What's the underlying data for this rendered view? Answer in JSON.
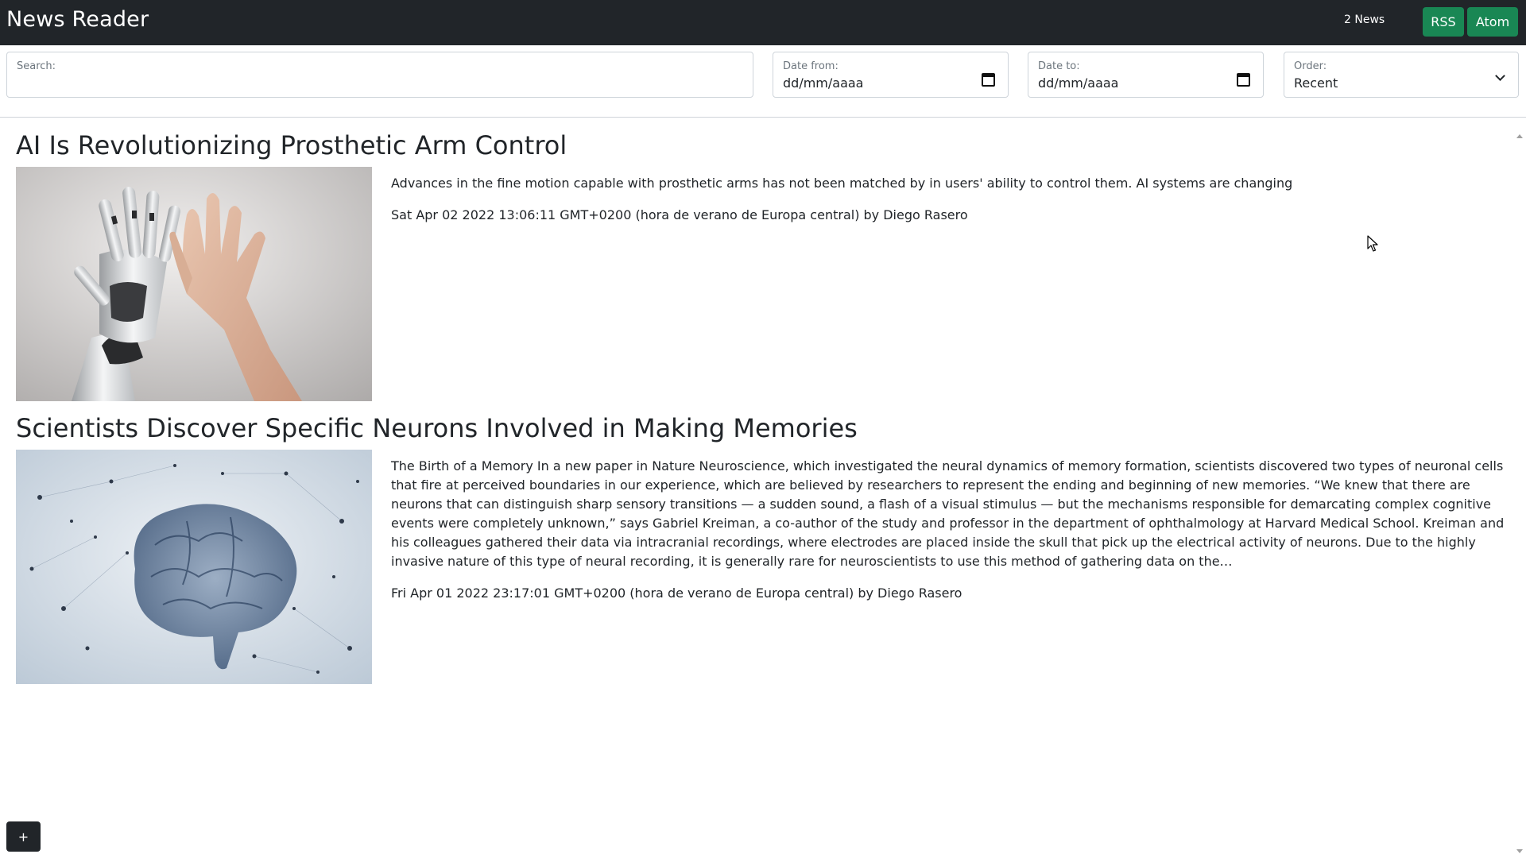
{
  "header": {
    "title": "News Reader",
    "news_count": "2 News",
    "rss_label": "RSS",
    "atom_label": "Atom",
    "accent_color": "#198754",
    "bar_color": "#212529"
  },
  "filters": {
    "search_label": "Search:",
    "search_value": "",
    "date_from_label": "Date from:",
    "date_from_value": "dd/mm/aaaa",
    "date_to_label": "Date to:",
    "date_to_value": "dd/mm/aaaa",
    "order_label": "Order:",
    "order_value": "Recent"
  },
  "articles": [
    {
      "title": "AI Is Revolutionizing Prosthetic Arm Control",
      "summary": "Advances in the fine motion capable with prosthetic arms has not been matched by in users' ability to control them. AI systems are changing",
      "meta": "Sat Apr 02 2022 13:06:11 GMT+0200 (hora de verano de Europa central) by Diego Rasero",
      "image": "robot-hand-high-five"
    },
    {
      "title": "Scientists Discover Specific Neurons Involved in Making Memories",
      "summary": "The Birth of a Memory In a new paper in Nature Neuroscience, which investigated the neural dynamics of memory formation, scientists discovered two types of neuronal cells that fire at perceived boundaries in our experience, which are believed by researchers to represent the ending and beginning of new memories. “We knew that there are neurons that can distinguish sharp sensory transitions — a sudden sound, a flash of a visual stimulus — but the mechanisms responsible for demarcating complex cognitive events were completely unknown,” says Gabriel Kreiman, a co-author of the study and professor in the department of ophthalmology at Harvard Medical School.  Kreiman and his colleagues gathered their data via intracranial recordings, where electrodes are placed inside the skull that pick up the electrical activity of neurons. Due to the highly invasive nature of this type of neural recording, it is generally rare for neuroscientists to use this method of gathering data on the…",
      "meta": "Fri Apr 01 2022 23:17:01 GMT+0200 (hora de verano de Europa central) by Diego Rasero",
      "image": "glass-brain-network"
    }
  ],
  "add_button_label": "+"
}
